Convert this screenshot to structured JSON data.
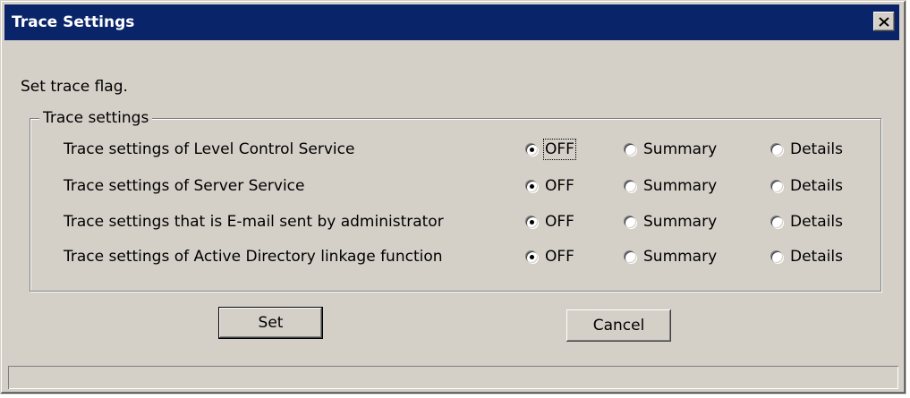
{
  "window": {
    "title": "Trace Settings",
    "close_glyph": "✕",
    "close_icon": "close-icon"
  },
  "prompt": "Set trace flag.",
  "group": {
    "legend": "Trace settings",
    "options": [
      "OFF",
      "Summary",
      "Details"
    ],
    "rows": [
      {
        "label": "Trace settings of Level Control Service",
        "selected": "OFF"
      },
      {
        "label": "Trace settings of Server Service",
        "selected": "OFF"
      },
      {
        "label": "Trace settings that is E-mail sent by administrator",
        "selected": "OFF"
      },
      {
        "label": "Trace settings of Active Directory linkage function",
        "selected": "OFF"
      }
    ]
  },
  "buttons": {
    "set": "Set",
    "cancel": "Cancel"
  },
  "colors": {
    "titlebar": "#0a246a",
    "face": "#d4d0c8"
  }
}
